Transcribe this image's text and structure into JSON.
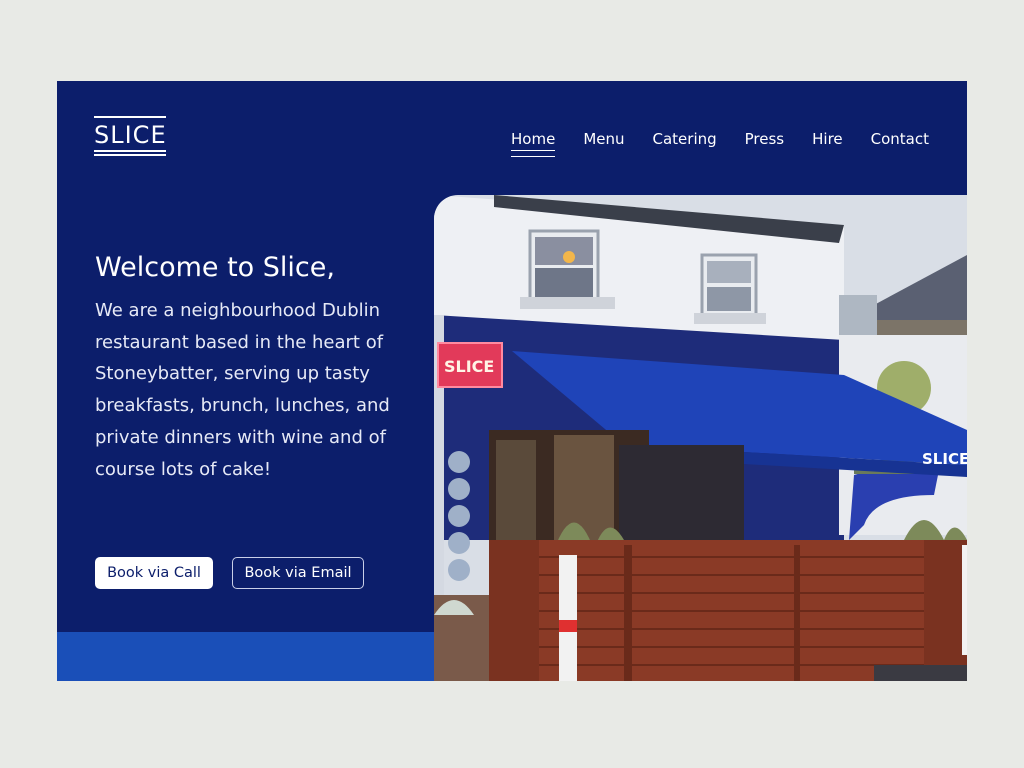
{
  "brand": {
    "logo_text": "SLICE"
  },
  "nav": {
    "items": [
      {
        "label": "Home",
        "active": true
      },
      {
        "label": "Menu",
        "active": false
      },
      {
        "label": "Catering",
        "active": false
      },
      {
        "label": "Press",
        "active": false
      },
      {
        "label": "Hire",
        "active": false
      },
      {
        "label": "Contact",
        "active": false
      }
    ]
  },
  "hero": {
    "title": "Welcome to Slice,",
    "body": "We are a neighbourhood Dublin restaurant based in the heart of Stoneybatter, serving up tasty breakfasts, brunch, lunches, and private dinners with wine and of course lots of cake!",
    "buttons": {
      "call_label": "Book via Call",
      "email_label": "Book via Email"
    }
  },
  "photo": {
    "sign_text": "SLICE",
    "awning_text": "SLICE"
  },
  "colors": {
    "page_bg": "#e8eae6",
    "brand_navy": "#0c1e6b",
    "accent_blue": "#1a4fb8",
    "white": "#ffffff"
  }
}
